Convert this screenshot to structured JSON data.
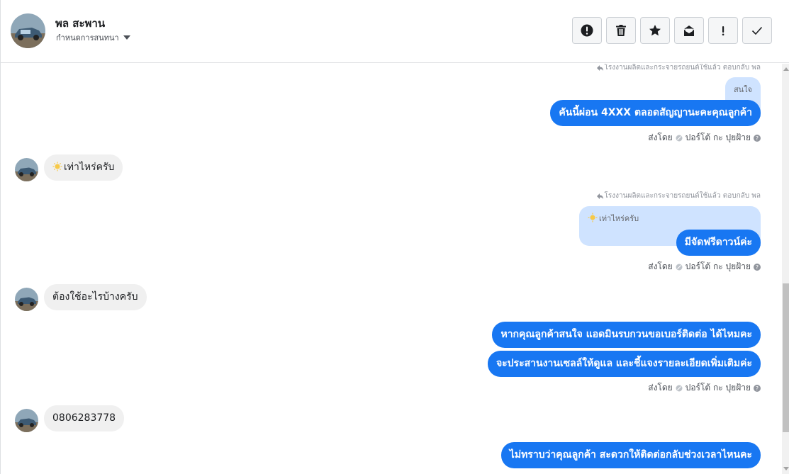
{
  "header": {
    "contact_name": "พล สะพาน",
    "assign_label": "กำหนดการสนทนา",
    "avatar_icon": "car-photo-avatar",
    "toolbar": [
      {
        "name": "spam-button",
        "icon": "alert-circle-icon"
      },
      {
        "name": "delete-button",
        "icon": "trash-icon"
      },
      {
        "name": "star-button",
        "icon": "star-icon"
      },
      {
        "name": "mark-unread-button",
        "icon": "envelope-icon"
      },
      {
        "name": "follow-up-button",
        "icon": "exclamation-icon"
      },
      {
        "name": "mark-done-button",
        "icon": "check-icon"
      }
    ]
  },
  "colors": {
    "outgoing_bubble": "#1877f2",
    "quoted_bubble": "#cfe3ff",
    "incoming_bubble": "#f0f0f0"
  },
  "thread": {
    "reply_note_1": "โรงงานผลิตและกระจายรถยนต์ใช้แล้ว ตอบกลับ พล",
    "quoted_1": "สนใจ",
    "out_1": "คันนี้ผ่อน 4XXX ตลอดสัญญานะคะคุณลูกค้า",
    "sender_1": "ส่งโดย",
    "sender_name_1": "ปอร์โต้ กะ ปุยฝ้าย",
    "in_1": "เท่าไหร่ครับ",
    "reply_note_2": "โรงงานผลิตและกระจายรถยนต์ใช้แล้ว ตอบกลับ พล",
    "quoted_2": "เท่าไหร่ครับ",
    "out_2": "มีจัดฟรีดาวน์ค่ะ",
    "sender_2": "ส่งโดย",
    "sender_name_2": "ปอร์โต้ กะ ปุยฝ้าย",
    "in_2": "ต้องใช้อะไรบ้างครับ",
    "out_3": "หากคุณลูกค้าสนใจ แอดมินรบกวนขอเบอร์ติดต่อ ได้ไหมคะ",
    "out_4": "จะประสานงานเซลล์ให้ดูแล และชี้แจงรายละเอียดเพิ่มเติมค่ะ",
    "sender_3": "ส่งโดย",
    "sender_name_3": "ปอร์โต้ กะ ปุยฝ้าย",
    "in_3": "0806283778",
    "out_5": "ไม่ทราบว่าคุณลูกค้า สะดวกให้ติดต่อกลับช่วงเวลาไหนคะ"
  }
}
